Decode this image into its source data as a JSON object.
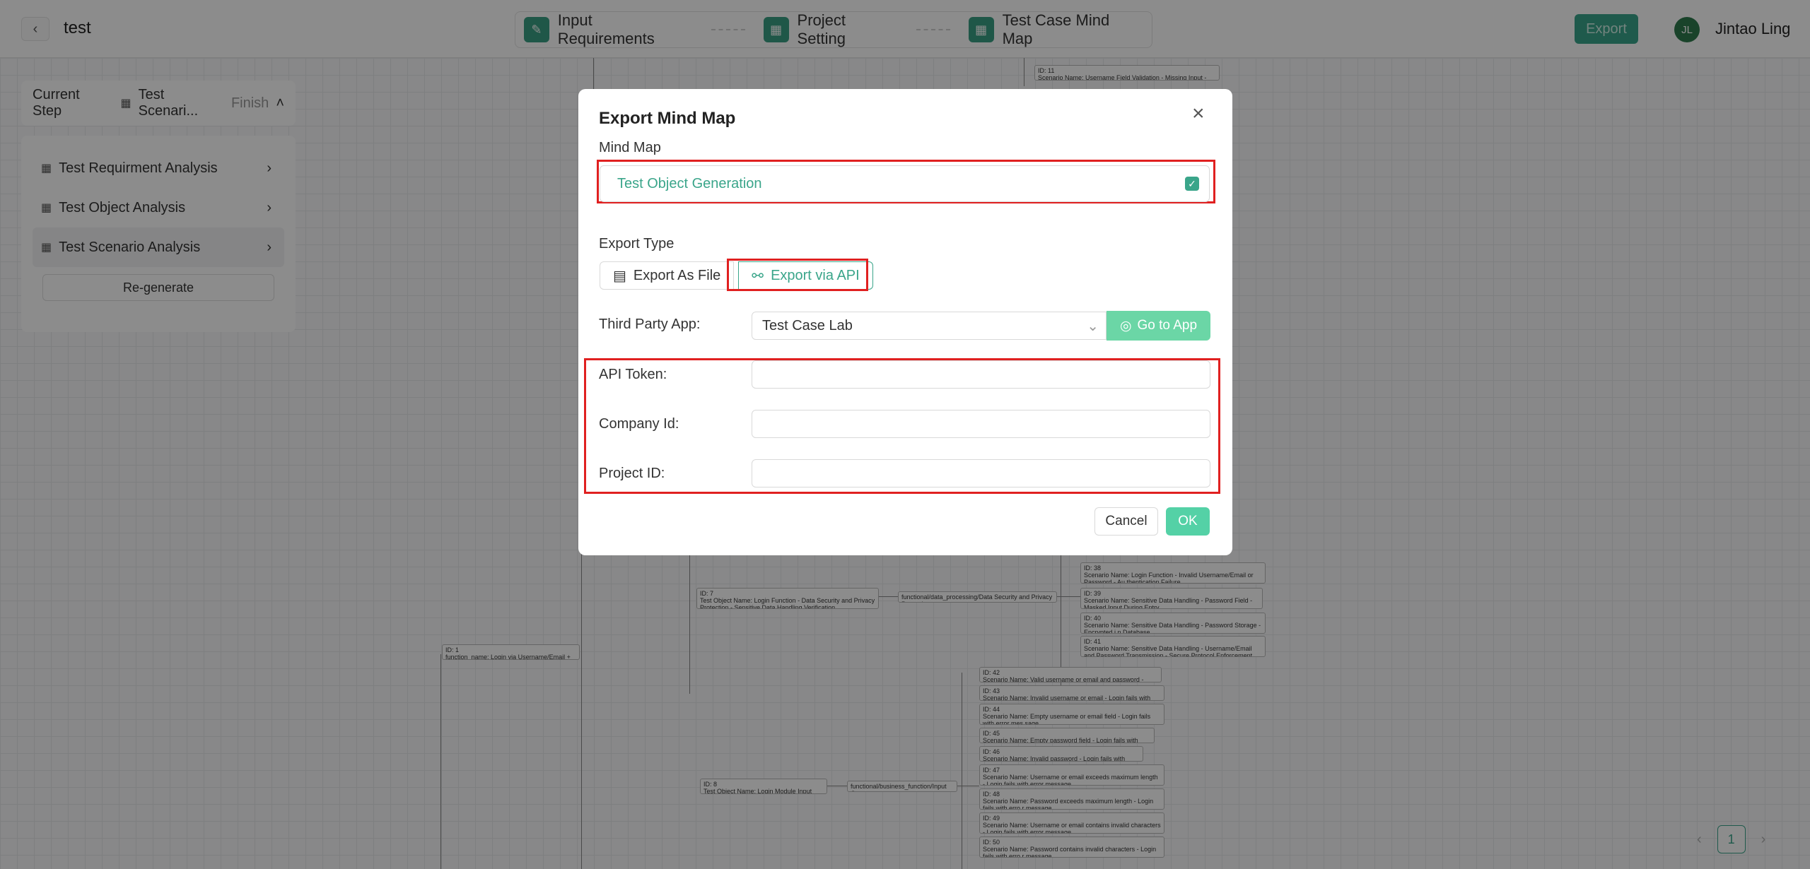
{
  "header": {
    "project_title": "test",
    "steps": [
      {
        "label": "Input Requirements",
        "icon": "edit-icon"
      },
      {
        "label": "Project Setting",
        "icon": "grid-icon"
      },
      {
        "label": "Test Case Mind Map",
        "icon": "grid-icon"
      }
    ],
    "export_label": "Export",
    "user_initials": "JL",
    "user_name": "Jintao Ling"
  },
  "sidebar": {
    "current_step_label": "Current Step",
    "current_step_value": "Test Scenari...",
    "current_step_status": "Finish",
    "items": [
      {
        "label": "Test Requirment Analysis"
      },
      {
        "label": "Test Object Analysis"
      },
      {
        "label": "Test Scenario Analysis"
      }
    ],
    "regenerate_label": "Re-generate"
  },
  "mindmap": {
    "nodes": [
      {
        "id_label": "ID: 11",
        "text": "Scenario Name: Username Field Validation - Missing Input - Error Prompt"
      },
      {
        "id_label": "ID: 38",
        "text": "Scenario Name: Login Function - Invalid Username/Email or Password - Au thentication Failure"
      },
      {
        "id_label": "ID: 39",
        "text": "Scenario Name: Sensitive Data Handling - Password Field - Masked Input During Entry"
      },
      {
        "id_label": "ID: 40",
        "text": "Scenario Name: Sensitive Data Handling - Password Storage - Encrypted i n Database"
      },
      {
        "id_label": "ID: 41",
        "text": "Scenario Name: Sensitive Data Handling - Username/Email and Password Transmission - Secure Protocol Enforcement"
      },
      {
        "id_label": "ID: 7",
        "text": "Test Object Name: Login Function - Data Security and Privacy Protection - Sensitive Data Handling Verification"
      },
      {
        "id_label": "",
        "text": "functional/data_processing/Data Security and Privacy Protection"
      },
      {
        "id_label": "ID: 1",
        "text": "function_name: Login via Username/Email + Password"
      },
      {
        "id_label": "ID: 42",
        "text": "Scenario Name: Valid username or email and password - Successful login"
      },
      {
        "id_label": "ID: 43",
        "text": "Scenario Name: Invalid username or email - Login fails with error message"
      },
      {
        "id_label": "ID: 44",
        "text": "Scenario Name: Empty username or email field - Login fails with error mes sage"
      },
      {
        "id_label": "ID: 45",
        "text": "Scenario Name: Empty password field - Login fails with error message"
      },
      {
        "id_label": "ID: 46",
        "text": "Scenario Name: Invalid password - Login fails with error message"
      },
      {
        "id_label": "ID: 47",
        "text": "Scenario Name: Username or email exceeds maximum length - Login fails with error message"
      },
      {
        "id_label": "ID: 48",
        "text": "Scenario Name: Password exceeds maximum length - Login fails with erro r message"
      },
      {
        "id_label": "ID: 49",
        "text": "Scenario Name: Username or email contains invalid characters - Login fails with error message"
      },
      {
        "id_label": "ID: 50",
        "text": "Scenario Name: Password contains invalid characters - Login fails with erro r message"
      },
      {
        "id_label": "ID: 8",
        "text": "Test Object Name: Login Module Input Validation"
      },
      {
        "id_label": "",
        "text": "functional/business_function/Input Output"
      }
    ]
  },
  "pagination": {
    "prev": "‹",
    "page": "1",
    "next": "›"
  },
  "modal": {
    "title": "Export Mind Map",
    "close_icon": "×",
    "mind_map_label": "Mind Map",
    "mind_map_value": "Test Object Generation",
    "export_type_label": "Export Type",
    "export_as_file_label": "Export As File",
    "export_via_api_label": "Export via API",
    "third_party_label": "Third Party App:",
    "third_party_value": "Test Case Lab",
    "go_to_app_label": "Go to App",
    "api_token_label": "API Token:",
    "company_id_label": "Company Id:",
    "project_id_label": "Project ID:",
    "api_token_value": "",
    "company_id_value": "",
    "project_id_value": "",
    "cancel_label": "Cancel",
    "ok_label": "OK"
  },
  "colors": {
    "accent": "#3aa58a",
    "highlight": "#e02020",
    "ok": "#54d1a6"
  }
}
